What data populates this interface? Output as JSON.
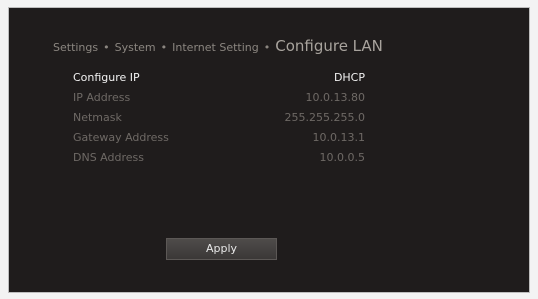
{
  "breadcrumb": {
    "items": [
      "Settings",
      "System",
      "Internet Setting"
    ],
    "separator": "•",
    "current": "Configure LAN"
  },
  "settings": [
    {
      "label": "Configure IP",
      "value": "DHCP"
    },
    {
      "label": "IP Address",
      "value": "10.0.13.80"
    },
    {
      "label": "Netmask",
      "value": "255.255.255.0"
    },
    {
      "label": "Gateway Address",
      "value": "10.0.13.1"
    },
    {
      "label": "DNS Address",
      "value": "10.0.0.5"
    }
  ],
  "apply_label": "Apply"
}
